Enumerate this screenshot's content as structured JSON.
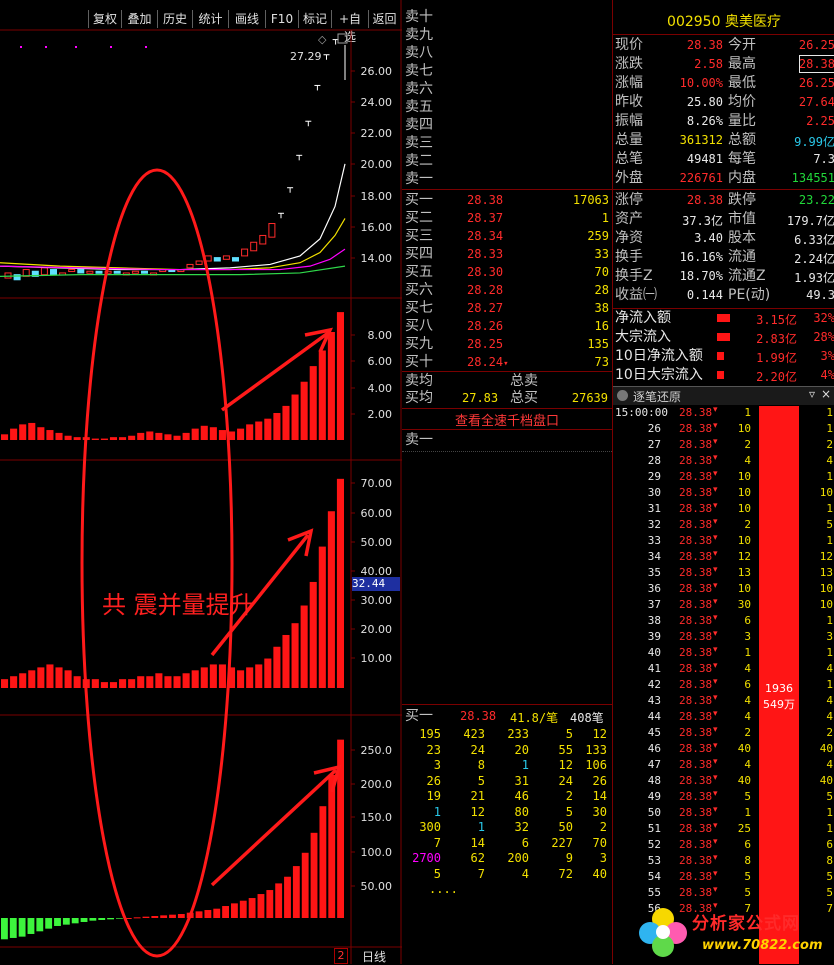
{
  "toolbar": {
    "buttons": [
      "复权",
      "叠加",
      "历史",
      "统计",
      "画线",
      "F10",
      "标记",
      "+自选",
      "返回"
    ]
  },
  "chart": {
    "price_label_top": "27.29",
    "price_ticks": [
      "26.00",
      "24.00",
      "22.00",
      "20.00",
      "18.00",
      "16.00",
      "14.00"
    ],
    "pane2_ticks": [
      "8.00",
      "6.00",
      "4.00",
      "2.00"
    ],
    "pane3_ticks": [
      "70.00",
      "60.00",
      "50.00",
      "40.00",
      "30.00",
      "20.00",
      "10.00"
    ],
    "pane3_marker": "32.44",
    "pane4_ticks": [
      "250.0",
      "200.0",
      "150.0",
      "100.0",
      "50.00"
    ],
    "annotation": "共 震并量提升",
    "bottom_tab": "日线",
    "bottom_num": "2"
  },
  "chart_data": {
    "type": "bar",
    "pane2_values": [
      0.4,
      0.8,
      1.1,
      1.2,
      0.9,
      0.7,
      0.5,
      0.3,
      0.2,
      0.2,
      0.1,
      0.1,
      0.2,
      0.2,
      0.3,
      0.5,
      0.6,
      0.5,
      0.4,
      0.3,
      0.5,
      0.8,
      1.0,
      0.9,
      0.7,
      0.6,
      0.8,
      1.1,
      1.3,
      1.5,
      1.9,
      2.4,
      3.2,
      4.1,
      5.2,
      6.3,
      7.6,
      9.0
    ],
    "pane3_values": [
      3,
      4,
      5,
      6,
      7,
      8,
      7,
      6,
      4,
      3,
      3,
      2,
      2,
      3,
      3,
      4,
      4,
      5,
      4,
      4,
      5,
      6,
      7,
      8,
      8,
      7,
      6,
      7,
      8,
      10,
      14,
      18,
      22,
      28,
      36,
      48,
      60,
      71
    ],
    "pane4_values": [
      -32,
      -30,
      -28,
      -24,
      -20,
      -16,
      -12,
      -10,
      -8,
      -6,
      -4,
      -3,
      -2,
      -1,
      0,
      1,
      2,
      3,
      4,
      5,
      6,
      8,
      10,
      12,
      14,
      18,
      22,
      26,
      30,
      36,
      42,
      52,
      62,
      78,
      98,
      128,
      168,
      215,
      268
    ]
  },
  "orderbook": {
    "sell_labels": [
      "卖十",
      "卖九",
      "卖八",
      "卖七",
      "卖六",
      "卖五",
      "卖四",
      "卖三",
      "卖二",
      "卖一"
    ],
    "buy": [
      {
        "label": "买一",
        "price": "28.38",
        "vol": "17063"
      },
      {
        "label": "买二",
        "price": "28.37",
        "vol": "1"
      },
      {
        "label": "买三",
        "price": "28.34",
        "vol": "259"
      },
      {
        "label": "买四",
        "price": "28.33",
        "vol": "33"
      },
      {
        "label": "买五",
        "price": "28.30",
        "vol": "70"
      },
      {
        "label": "买六",
        "price": "28.28",
        "vol": "28"
      },
      {
        "label": "买七",
        "price": "28.27",
        "vol": "38"
      },
      {
        "label": "买八",
        "price": "28.26",
        "vol": "16"
      },
      {
        "label": "买九",
        "price": "28.25",
        "vol": "135"
      },
      {
        "label": "买十",
        "price": "28.24",
        "vol": "73"
      }
    ],
    "sell_avg_label": "卖均",
    "total_sell_label": "总卖",
    "buy_avg_label": "买均",
    "buy_avg": "27.83",
    "total_buy_label": "总买",
    "total_buy": "27639",
    "view_all_btn": "查看全速千档盘口",
    "sell1_label": "卖一",
    "queue_header": {
      "label": "买一",
      "price": "28.38",
      "per": "41.8/笔",
      "count": "408笔"
    },
    "queue_rows": [
      [
        "195",
        "423",
        "233",
        "5",
        "12"
      ],
      [
        "23",
        "24",
        "20",
        "55",
        "133"
      ],
      [
        "3",
        "8",
        "1",
        "12",
        "106"
      ],
      [
        "26",
        "5",
        "31",
        "24",
        "26"
      ],
      [
        "19",
        "21",
        "46",
        "2",
        "14"
      ],
      [
        "1",
        "12",
        "80",
        "5",
        "30"
      ],
      [
        "300",
        "1",
        "32",
        "50",
        "2"
      ],
      [
        "7",
        "14",
        "6",
        "227",
        "70"
      ],
      [
        "2700",
        "62",
        "200",
        "9",
        "3"
      ],
      [
        "5",
        "7",
        "4",
        "72",
        "40"
      ]
    ],
    "queue_more": "...."
  },
  "quote": {
    "code": "002950",
    "name": "奥美医疗",
    "rows": [
      {
        "l": "现价",
        "v": "28.38",
        "r": "今开",
        "rv": "26.25"
      },
      {
        "l": "涨跌",
        "v": "2.58",
        "r": "最高",
        "rv": "28.38"
      },
      {
        "l": "涨幅",
        "v": "10.00%",
        "r": "最低",
        "rv": "26.25"
      },
      {
        "l": "昨收",
        "v": "25.80",
        "r": "均价",
        "rv": "27.64"
      },
      {
        "l": "振幅",
        "v": "8.26%",
        "r": "量比",
        "rv": "2.25"
      },
      {
        "l": "总量",
        "v": "361312",
        "r": "总额",
        "rv": "9.99亿"
      },
      {
        "l": "总笔",
        "v": "49481",
        "r": "每笔",
        "rv": "7.3"
      },
      {
        "l": "外盘",
        "v": "226761",
        "r": "内盘",
        "rv": "134551"
      }
    ],
    "rows2": [
      {
        "l": "涨停",
        "v": "28.38",
        "r": "跌停",
        "rv": "23.22"
      },
      {
        "l": "资产",
        "v": "37.3亿",
        "r": "市值",
        "rv": "179.7亿"
      },
      {
        "l": "净资",
        "v": "3.40",
        "r": "股本",
        "rv": "6.33亿"
      },
      {
        "l": "换手",
        "v": "16.16%",
        "r": "流通",
        "rv": "2.24亿"
      },
      {
        "l": "换手Z",
        "v": "18.70%",
        "r": "流通Z",
        "rv": "1.93亿"
      },
      {
        "l": "收益㈠",
        "v": "0.144",
        "r": "PE(动)",
        "rv": "49.3"
      }
    ],
    "flows": [
      {
        "l": "净流入额",
        "v": "3.15亿",
        "p": "32%",
        "bar": 0.45
      },
      {
        "l": "大宗流入",
        "v": "2.83亿",
        "p": "28%",
        "bar": 0.45
      },
      {
        "l": "10日净流入额",
        "v": "1.99亿",
        "p": "3%",
        "bar": 0.25
      },
      {
        "l": "10日大宗流入",
        "v": "2.20亿",
        "p": "4%",
        "bar": 0.25
      }
    ]
  },
  "ticks": {
    "title": "逐笔还原",
    "first_time": "15:00:00",
    "rows": [
      {
        "t": "15:00:00",
        "p": "28.38",
        "n": "1",
        "r": "1"
      },
      {
        "t": "26",
        "p": "28.38",
        "n": "10",
        "r": "1"
      },
      {
        "t": "27",
        "p": "28.38",
        "n": "2",
        "r": "2"
      },
      {
        "t": "28",
        "p": "28.38",
        "n": "4",
        "r": "4"
      },
      {
        "t": "29",
        "p": "28.38",
        "n": "10",
        "r": "1"
      },
      {
        "t": "30",
        "p": "28.38",
        "n": "10",
        "r": "10"
      },
      {
        "t": "31",
        "p": "28.38",
        "n": "10",
        "r": "1"
      },
      {
        "t": "32",
        "p": "28.38",
        "n": "2",
        "r": "5"
      },
      {
        "t": "33",
        "p": "28.38",
        "n": "10",
        "r": "1"
      },
      {
        "t": "34",
        "p": "28.38",
        "n": "12",
        "r": "12"
      },
      {
        "t": "35",
        "p": "28.38",
        "n": "13",
        "r": "13"
      },
      {
        "t": "36",
        "p": "28.38",
        "n": "10",
        "r": "10"
      },
      {
        "t": "37",
        "p": "28.38",
        "n": "30",
        "r": "10"
      },
      {
        "t": "38",
        "p": "28.38",
        "n": "6",
        "r": "1"
      },
      {
        "t": "39",
        "p": "28.38",
        "n": "3",
        "r": "3"
      },
      {
        "t": "40",
        "p": "28.38",
        "n": "1",
        "r": "1"
      },
      {
        "t": "41",
        "p": "28.38",
        "n": "4",
        "r": "4"
      },
      {
        "t": "42",
        "p": "28.38",
        "n": "6",
        "r": "1"
      },
      {
        "t": "43",
        "p": "28.38",
        "n": "4",
        "r": "4"
      },
      {
        "t": "44",
        "p": "28.38",
        "n": "4",
        "r": "4"
      },
      {
        "t": "45",
        "p": "28.38",
        "n": "2",
        "r": "2"
      },
      {
        "t": "46",
        "p": "28.38",
        "n": "40",
        "r": "40"
      },
      {
        "t": "47",
        "p": "28.38",
        "n": "4",
        "r": "4"
      },
      {
        "t": "48",
        "p": "28.38",
        "n": "40",
        "r": "40"
      },
      {
        "t": "49",
        "p": "28.38",
        "n": "5",
        "r": "5"
      },
      {
        "t": "50",
        "p": "28.38",
        "n": "1",
        "r": "1"
      },
      {
        "t": "51",
        "p": "28.38",
        "n": "25",
        "r": "1"
      },
      {
        "t": "52",
        "p": "28.38",
        "n": "6",
        "r": "6"
      },
      {
        "t": "53",
        "p": "28.38",
        "n": "8",
        "r": "8"
      },
      {
        "t": "54",
        "p": "28.38",
        "n": "5",
        "r": "5"
      },
      {
        "t": "55",
        "p": "28.38",
        "n": "5",
        "r": "5"
      },
      {
        "t": "56",
        "p": "28.38",
        "n": "7",
        "r": "7"
      }
    ],
    "big_bar_text1": "1936",
    "big_bar_text2": "549万"
  },
  "watermark": {
    "brand": "分析家公式网",
    "url": "www.70822.com"
  }
}
